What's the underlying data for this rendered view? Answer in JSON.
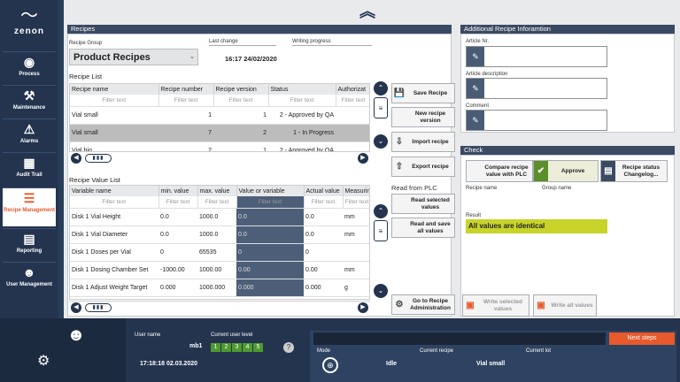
{
  "app": {
    "logo_text": "zenon"
  },
  "sidebar": {
    "items": [
      {
        "label": "Process",
        "icon": "eye-icon",
        "glyph": "◉"
      },
      {
        "label": "Maintenance",
        "icon": "wrench-icon",
        "glyph": "⚒"
      },
      {
        "label": "Alarms",
        "icon": "siren-icon",
        "glyph": "⚠"
      },
      {
        "label": "Audit Trail",
        "icon": "calendar-icon",
        "glyph": "▦"
      },
      {
        "label": "Recipe Management",
        "icon": "list-icon",
        "glyph": "☰"
      },
      {
        "label": "Reporting",
        "icon": "report-icon",
        "glyph": "▤"
      },
      {
        "label": "User Management",
        "icon": "users-icon",
        "glyph": "👥"
      }
    ]
  },
  "recipes": {
    "title": "Recipes",
    "group_label": "Recipe Group",
    "group_value": "Product Recipes",
    "last_change_label": "Last change",
    "last_change_value": "16:17 24/02/2020",
    "writing_progress_label": "Writing progress",
    "list_title": "Recipe List",
    "columns": [
      "Recipe name",
      "Recipe number",
      "Recipe version",
      "Status",
      "Authorizat"
    ],
    "filter_text": "Filter text",
    "rows": [
      [
        "Vial small",
        "1",
        "1",
        "2 - Approved by QA",
        ""
      ],
      [
        "Vial small",
        "7",
        "2",
        "1 - In Progress",
        ""
      ],
      [
        "Vial big",
        "2",
        "1",
        "2 - Approved by QA",
        ""
      ]
    ],
    "selected_row": 1
  },
  "values": {
    "title": "Recipe Value List",
    "columns": [
      "Variable name",
      "min. value",
      "max. value",
      "Value or variable",
      "Actual value",
      "Measuring"
    ],
    "rows": [
      [
        "Disk 1 Vial Height",
        "0.0",
        "1000.0",
        "0.0",
        "0.0",
        "mm"
      ],
      [
        "Disk 1 Vial Diameter",
        "0.0",
        "1000.0",
        "0.0",
        "0.0",
        "mm"
      ],
      [
        "Disk 1 Doses per Vial",
        "0",
        "65535",
        "0",
        "0",
        ""
      ],
      [
        "Disk 1 Dosing Chamber Set",
        "-1000.00",
        "1000.00",
        "0.00",
        "0.00",
        "mm"
      ],
      [
        "Disk 1 Adjust Weight Target",
        "0.000",
        "1000.000",
        "0.000",
        "0.000",
        "g"
      ]
    ]
  },
  "actions": {
    "save": "Save Recipe",
    "new_version": "New recipe version",
    "import": "Import recipe",
    "export": "Export recipe",
    "read_from_plc": "Read from PLC",
    "read_selected": "Read selected values",
    "read_save_all": "Read and save all values",
    "goto_admin": "Go to Recipe Administration",
    "write_selected": "Write selected values",
    "write_all": "Write all values"
  },
  "additional": {
    "title": "Additional Recipe Inforamtion",
    "article_nr": "Article Nr.",
    "article_desc": "Article description",
    "comment": "Comment"
  },
  "check": {
    "title": "Check",
    "compare": "Compare recipe value with PLC",
    "approve": "Approve",
    "status_changelog": "Recipe status Changelog...",
    "recipe_name_label": "Recipe name",
    "group_name_label": "Group name",
    "result_label": "Result",
    "result_value": "All values are identical",
    "result_color": "#c8d42a"
  },
  "footer": {
    "user_name_label": "User name",
    "user_name": "mb1",
    "user_level_label": "Current user level",
    "levels": [
      "1",
      "2",
      "3",
      "4",
      "5"
    ],
    "help": "?",
    "datetime": "17:18:18 02.03.2020",
    "mode_label": "Mode",
    "mode_value": "Idle",
    "current_recipe_label": "Current recipe",
    "current_recipe": "Vial small",
    "current_lot_label": "Current lot",
    "next_steps": "Next steps"
  }
}
